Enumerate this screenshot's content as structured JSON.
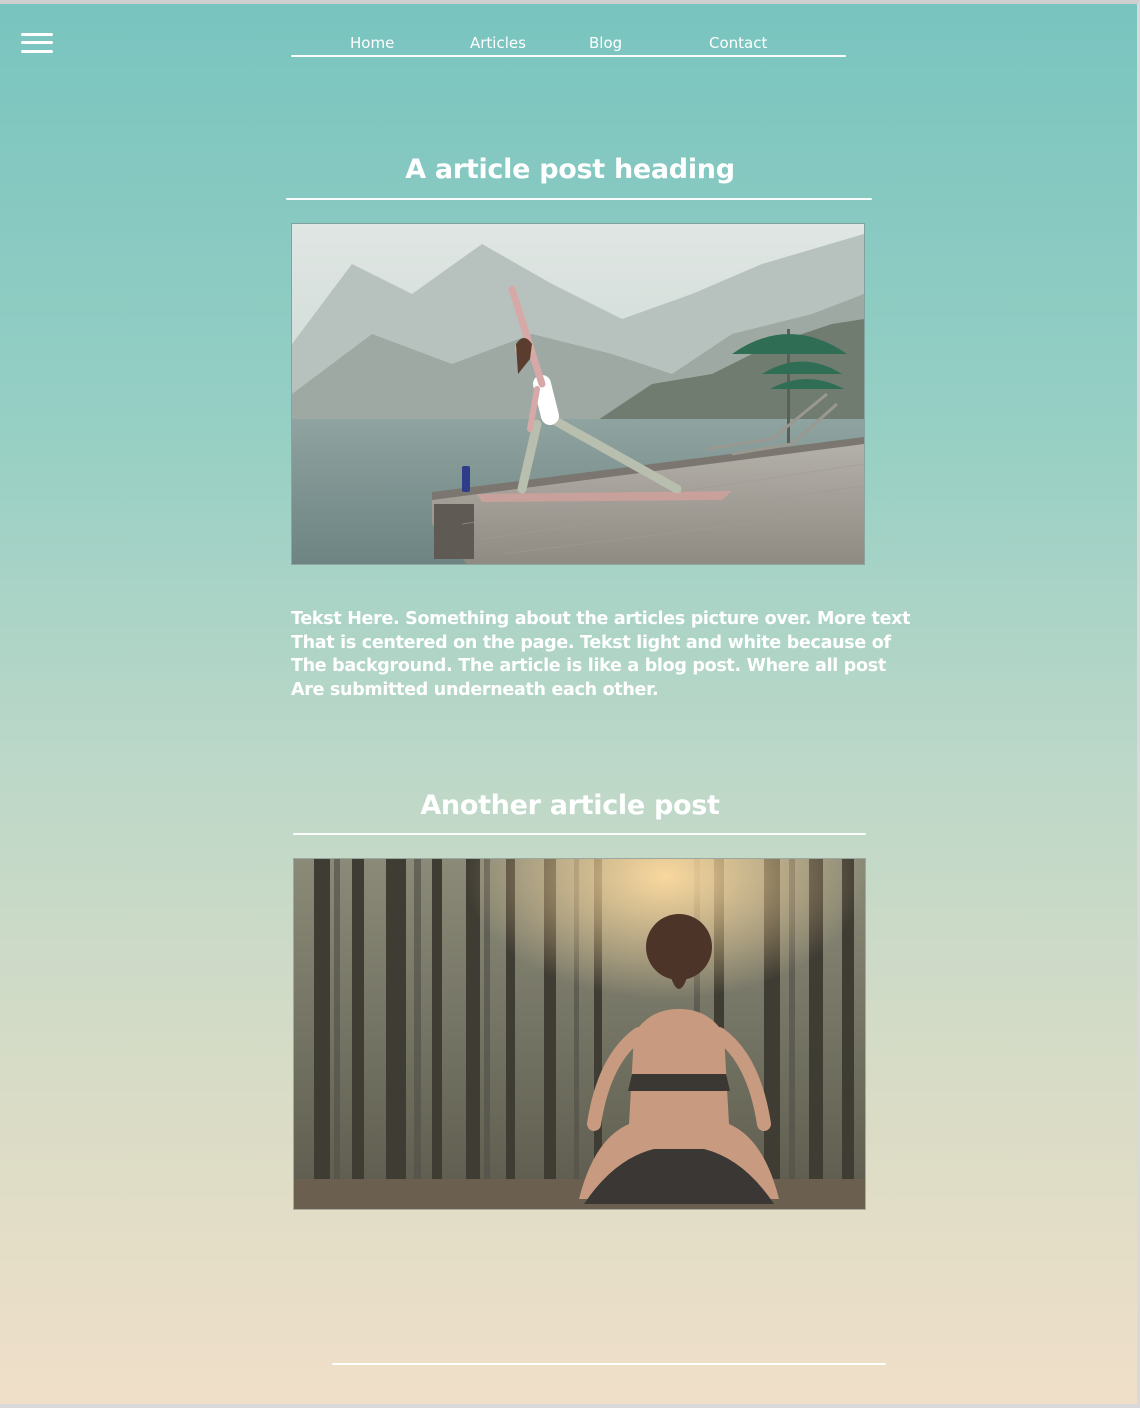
{
  "header": {
    "menu_icon": "hamburger-menu-icon",
    "nav": [
      {
        "label": "Home"
      },
      {
        "label": "Articles"
      },
      {
        "label": "Blog"
      },
      {
        "label": "Contact"
      }
    ]
  },
  "posts": [
    {
      "heading": "A article post heading",
      "image": "photo of a woman doing a yoga pose on a lakeside pier",
      "text_lines": [
        "Tekst Here. Something about the articles picture over. More text",
        "That is centered on the page. Tekst light and white because of",
        "The background. The article is like a blog post. Where all post",
        "Are submitted underneath each other."
      ]
    },
    {
      "heading": "Another article post",
      "image": "photo of a woman meditating in a pine forest"
    }
  ],
  "colors": {
    "gradient_top": "#79c4bf",
    "gradient_bottom": "#f0dfc8",
    "text": "#ffffff"
  }
}
